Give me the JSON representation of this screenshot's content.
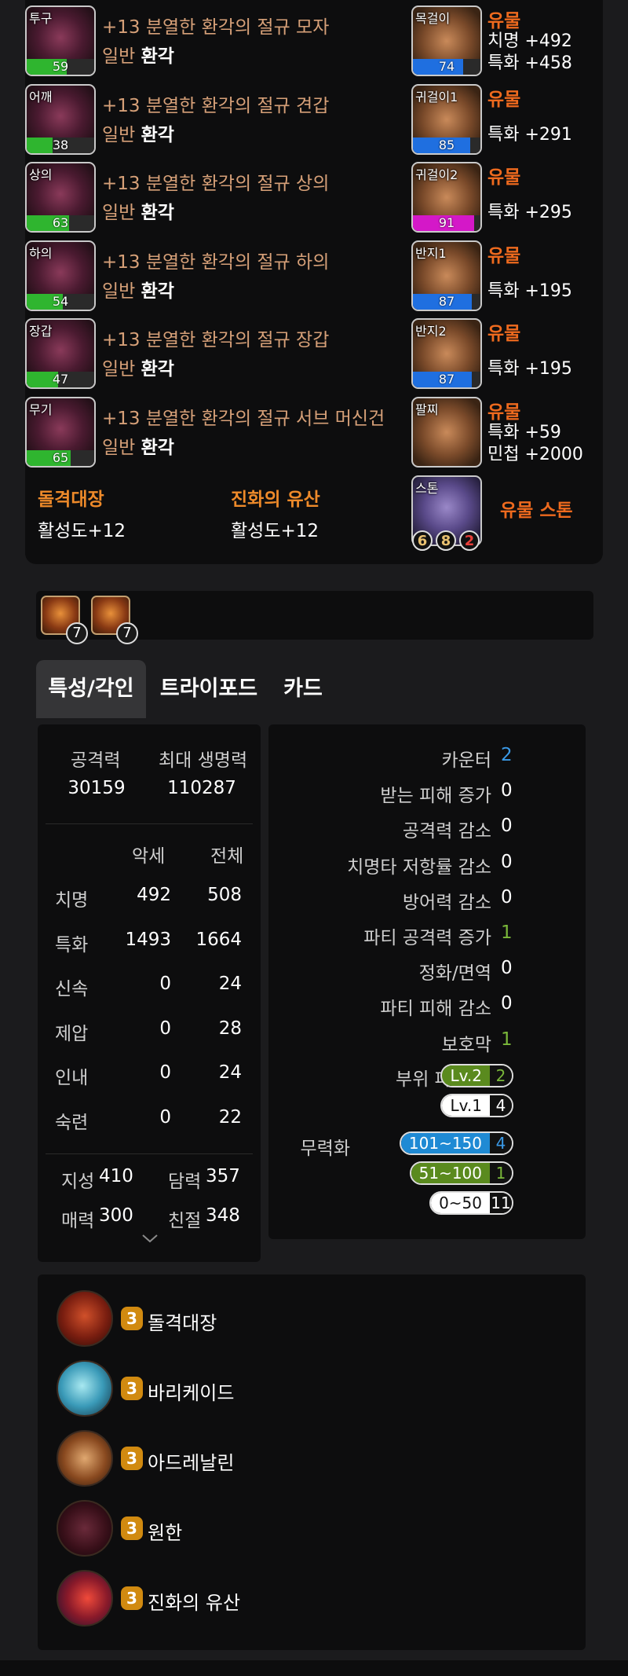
{
  "armor": [
    {
      "slot": "투구",
      "name": "+13 분열한 환각의 절규 모자",
      "grade": "일반",
      "quality_label": "환각",
      "quality": 59,
      "bar_color": "#2fb52f"
    },
    {
      "slot": "어깨",
      "name": "+13 분열한 환각의 절규 견갑",
      "grade": "일반",
      "quality_label": "환각",
      "quality": 38,
      "bar_color": "#2fb52f"
    },
    {
      "slot": "상의",
      "name": "+13 분열한 환각의 절규 상의",
      "grade": "일반",
      "quality_label": "환각",
      "quality": 63,
      "bar_color": "#2fb52f"
    },
    {
      "slot": "하의",
      "name": "+13 분열한 환각의 절규 하의",
      "grade": "일반",
      "quality_label": "환각",
      "quality": 54,
      "bar_color": "#2fb52f"
    },
    {
      "slot": "장갑",
      "name": "+13 분열한 환각의 절규 장갑",
      "grade": "일반",
      "quality_label": "환각",
      "quality": 47,
      "bar_color": "#2fb52f"
    },
    {
      "slot": "무기",
      "name": "+13 분열한 환각의 절규 서브 머신건",
      "grade": "일반",
      "quality_label": "환각",
      "quality": 65,
      "bar_color": "#2fb52f"
    }
  ],
  "accessories": [
    {
      "slot": "목걸이",
      "grade": "유물",
      "quality": 74,
      "bar_color": "#1f6fe0",
      "stats": [
        "치명 +492",
        "특화 +458"
      ]
    },
    {
      "slot": "귀걸이1",
      "grade": "유물",
      "quality": 85,
      "bar_color": "#1f6fe0",
      "stats": [
        "특화 +291"
      ]
    },
    {
      "slot": "귀걸이2",
      "grade": "유물",
      "quality": 91,
      "bar_color": "#d418c8",
      "stats": [
        "특화 +295"
      ]
    },
    {
      "slot": "반지1",
      "grade": "유물",
      "quality": 87,
      "bar_color": "#1f6fe0",
      "stats": [
        "특화 +195"
      ]
    },
    {
      "slot": "반지2",
      "grade": "유물",
      "quality": 87,
      "bar_color": "#1f6fe0",
      "stats": [
        "특화 +195"
      ]
    },
    {
      "slot": "팔찌",
      "grade": "유물",
      "stats": [
        "특화 +59",
        "민첩 +2000"
      ]
    }
  ],
  "set_effects": [
    {
      "name": "돌격대장",
      "value": "활성도+12"
    },
    {
      "name": "진화의 유산",
      "value": "활성도+12"
    }
  ],
  "stone": {
    "tag": "스톤",
    "label": "유물 스톤",
    "chips": [
      "6",
      "8",
      "2"
    ],
    "chip_colors": [
      "#e8c070",
      "#e8c070",
      "#e8403a"
    ]
  },
  "gems": [
    "7",
    "7"
  ],
  "tabs": [
    "특성/각인",
    "트라이포드",
    "카드"
  ],
  "basic_stats": {
    "attack_label": "공격력",
    "attack": "30159",
    "hp_label": "최대 생명력",
    "hp": "110287"
  },
  "stat_table": {
    "col_acc": "악세",
    "col_total": "전체",
    "rows": [
      {
        "name": "치명",
        "acc": "492",
        "total": "508"
      },
      {
        "name": "특화",
        "acc": "1493",
        "total": "1664"
      },
      {
        "name": "신속",
        "acc": "0",
        "total": "24"
      },
      {
        "name": "제압",
        "acc": "0",
        "total": "28"
      },
      {
        "name": "인내",
        "acc": "0",
        "total": "24"
      },
      {
        "name": "숙련",
        "acc": "0",
        "total": "22"
      }
    ]
  },
  "tendencies": [
    {
      "name": "지성",
      "value": "410"
    },
    {
      "name": "담력",
      "value": "357"
    },
    {
      "name": "매력",
      "value": "300"
    },
    {
      "name": "친절",
      "value": "348"
    }
  ],
  "expand_icon": "chevron-down-icon",
  "effects": [
    {
      "label": "카운터",
      "value": "2",
      "color": "#3a9ae8"
    },
    {
      "label": "받는 피해 증가",
      "value": "0",
      "color": "#ffffff"
    },
    {
      "label": "공격력 감소",
      "value": "0",
      "color": "#ffffff"
    },
    {
      "label": "치명타 저항률 감소",
      "value": "0",
      "color": "#ffffff"
    },
    {
      "label": "방어력 감소",
      "value": "0",
      "color": "#ffffff"
    },
    {
      "label": "파티 공격력 증가",
      "value": "1",
      "color": "#7ab83a"
    },
    {
      "label": "정화/면역",
      "value": "0",
      "color": "#ffffff"
    },
    {
      "label": "파티 피해 감소",
      "value": "0",
      "color": "#ffffff"
    },
    {
      "label": "보호막",
      "value": "1",
      "color": "#7ab83a"
    }
  ],
  "part_break": {
    "label": "부위 파괴",
    "pills": [
      {
        "level": "Lv.2",
        "count": "2",
        "bg": "#5a8a1e",
        "count_color": "#7ab83a",
        "text_color": "#ffffff"
      },
      {
        "level": "Lv.1",
        "count": "4",
        "bg": "#ffffff",
        "count_color": "#ffffff",
        "text_color": "#111111"
      }
    ]
  },
  "stagger": {
    "label": "무력화",
    "pills": [
      {
        "level": "101~150",
        "count": "4",
        "bg": "#1f8ad4",
        "count_color": "#3a9ae8",
        "text_color": "#ffffff"
      },
      {
        "level": "51~100",
        "count": "1",
        "bg": "#5a8a1e",
        "count_color": "#7ab83a",
        "text_color": "#ffffff"
      },
      {
        "level": "0~50",
        "count": "11",
        "bg": "#ffffff",
        "count_color": "#ffffff",
        "text_color": "#111111"
      }
    ]
  },
  "engravings": [
    {
      "level": "3",
      "name": "돌격대장",
      "icon": "charge-captain-icon",
      "bg": "radial-gradient(circle at 50% 45%, #d0502a 0%, #7a1e10 55%, #2a0a06 100%)"
    },
    {
      "level": "3",
      "name": "바리케이드",
      "icon": "barricade-icon",
      "bg": "radial-gradient(circle at 45% 45%, #a8e8f0 0%, #3a9ab8 50%, #123040 100%)"
    },
    {
      "level": "3",
      "name": "아드레날린",
      "icon": "adrenaline-icon",
      "bg": "radial-gradient(circle at 50% 50%, #e0a870 0%, #8a4a20 55%, #2a160a 100%)"
    },
    {
      "level": "3",
      "name": "원한",
      "icon": "grudge-icon",
      "bg": "radial-gradient(circle at 50% 50%, #6a2a3a 0%, #3a101a 55%, #120408 100%)"
    },
    {
      "level": "3",
      "name": "진화의 유산",
      "icon": "evolution-legacy-icon",
      "bg": "radial-gradient(circle at 55% 50%, #f04a3a 0%, #8a1a2a 50%, #1a1030 100%)"
    }
  ]
}
